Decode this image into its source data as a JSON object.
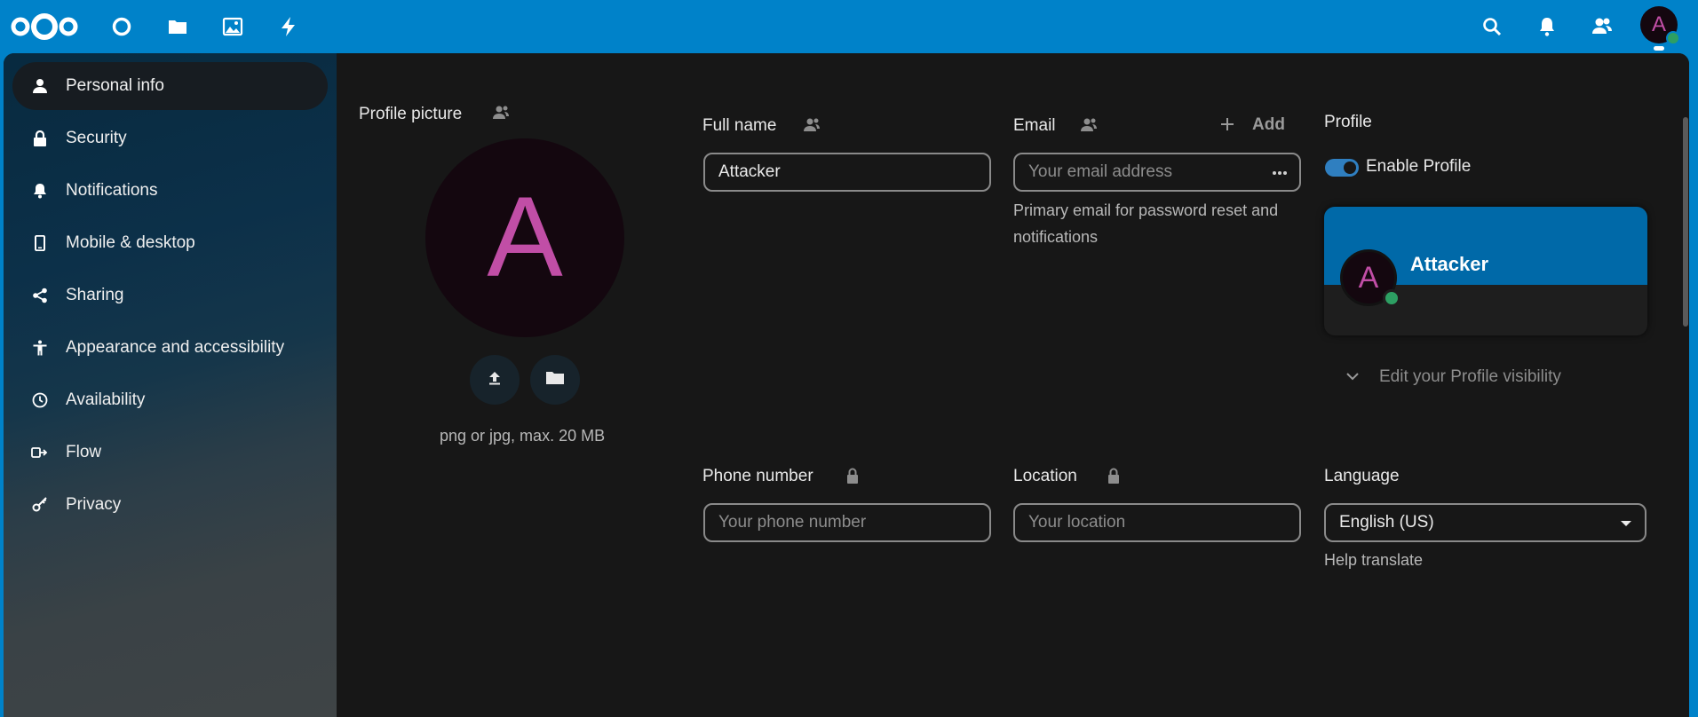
{
  "header": {
    "apps": [
      {
        "name": "logo-icon"
      },
      {
        "name": "dashboard-icon"
      },
      {
        "name": "files-icon"
      },
      {
        "name": "photos-icon"
      },
      {
        "name": "activity-icon"
      }
    ],
    "right_icons": [
      "search-icon",
      "notifications-bell-icon",
      "contacts-icon"
    ],
    "avatar_letter": "A"
  },
  "sidebar": {
    "items": [
      {
        "label": "Personal info",
        "icon": "person-icon",
        "active": true
      },
      {
        "label": "Security",
        "icon": "lock-icon"
      },
      {
        "label": "Notifications",
        "icon": "bell-icon"
      },
      {
        "label": "Mobile & desktop",
        "icon": "phone-icon"
      },
      {
        "label": "Sharing",
        "icon": "share-icon"
      },
      {
        "label": "Appearance and accessibility",
        "icon": "accessibility-icon"
      },
      {
        "label": "Availability",
        "icon": "clock-icon"
      },
      {
        "label": "Flow",
        "icon": "flow-icon"
      },
      {
        "label": "Privacy",
        "icon": "key-icon"
      }
    ]
  },
  "profile_picture": {
    "title": "Profile picture",
    "avatar_letter": "A",
    "hint": "png or jpg, max. 20 MB"
  },
  "full_name": {
    "label": "Full name",
    "value": "Attacker"
  },
  "email": {
    "label": "Email",
    "add_label": "Add",
    "placeholder": "Your email address",
    "help": "Primary email for password reset and notifications"
  },
  "profile": {
    "title": "Profile",
    "enable_label": "Enable Profile",
    "enabled": true,
    "card_name": "Attacker",
    "card_avatar_letter": "A",
    "visibility_label": "Edit your Profile visibility"
  },
  "phone": {
    "label": "Phone number",
    "placeholder": "Your phone number"
  },
  "location": {
    "label": "Location",
    "placeholder": "Your location"
  },
  "language": {
    "label": "Language",
    "selected": "English (US)",
    "help_link": "Help translate"
  },
  "colors": {
    "header": "#0082c9",
    "accent": "#2f7fc0",
    "avatar_letter": "#c14ea6",
    "status_online": "#2d9f63",
    "background": "#171717"
  }
}
